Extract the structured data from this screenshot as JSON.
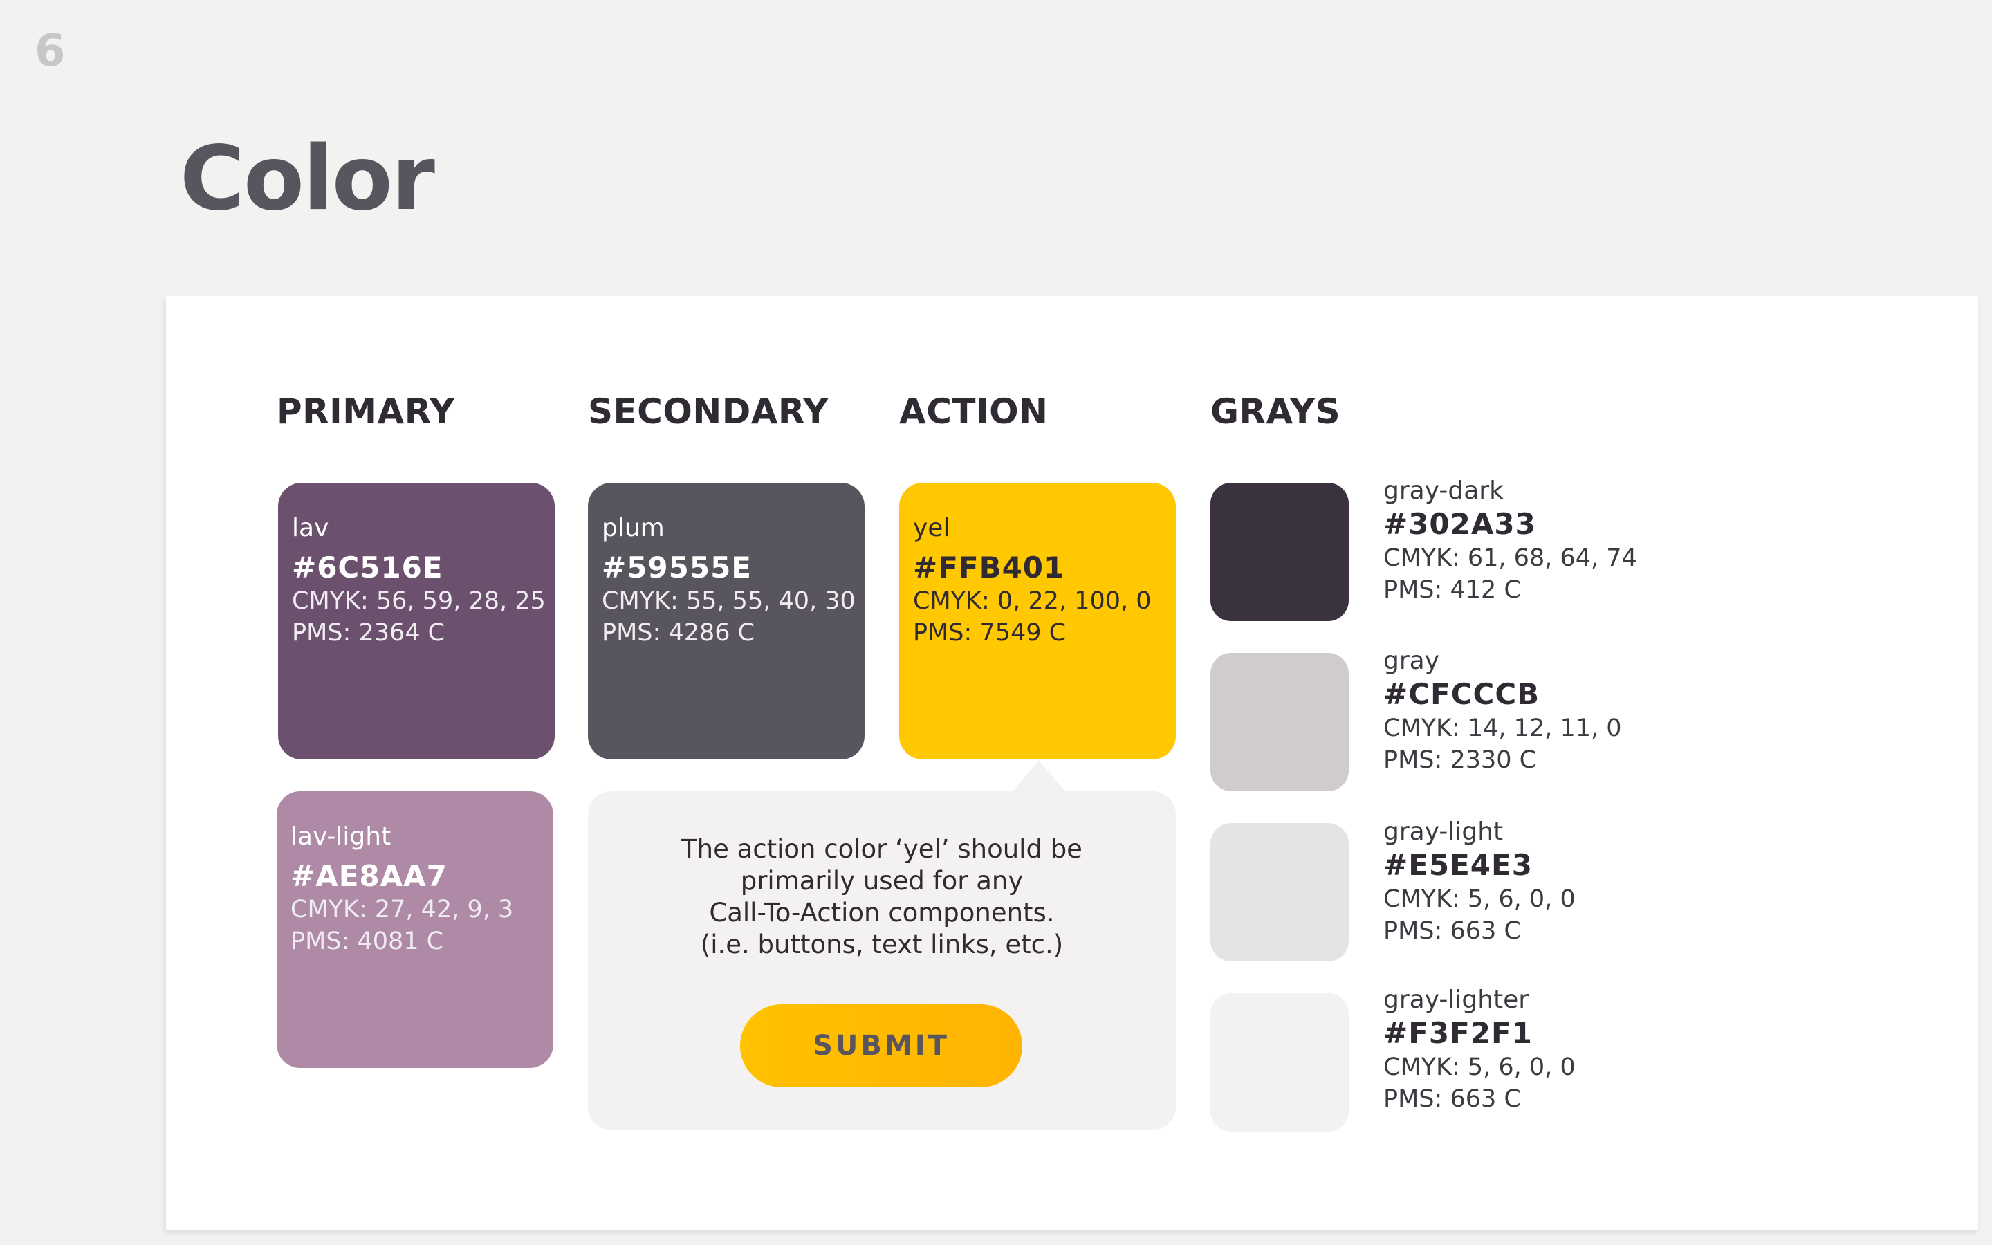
{
  "page": {
    "number": "6",
    "title": "Color"
  },
  "headings": {
    "primary": "PRIMARY",
    "secondary": "SECONDARY",
    "action": "ACTION",
    "grays": "GRAYS"
  },
  "colors": {
    "lav": {
      "name": "lav",
      "hex": "#6C516E",
      "cmyk": "CMYK: 56, 59, 28, 25",
      "pms": "PMS: 2364 C"
    },
    "lav_light": {
      "name": "lav-light",
      "hex": "#AE8AA7",
      "cmyk": "CMYK: 27, 42, 9, 3",
      "pms": "PMS: 4081 C"
    },
    "plum": {
      "name": "plum",
      "hex": "#59555E",
      "cmyk": "CMYK: 55, 55, 40, 30",
      "pms": "PMS: 4286 C"
    },
    "yel": {
      "name": "yel",
      "hex": "#FFB401",
      "cmyk": "CMYK: 0, 22, 100, 0",
      "pms": "PMS: 7549 C"
    }
  },
  "callout": {
    "lines": [
      "The action color ‘yel’ should be",
      "primarily used for any",
      "Call-To-Action components.",
      "(i.e. buttons, text links, etc.)"
    ],
    "button_label": "SUBMIT"
  },
  "grays": [
    {
      "name": "gray-dark",
      "hex": "#302A33",
      "cmyk": "CMYK: 61, 68, 64, 74",
      "pms": "PMS: 412 C"
    },
    {
      "name": "gray",
      "hex": "#CFCCCB",
      "cmyk": "CMYK: 14, 12, 11, 0",
      "pms": "PMS: 2330 C"
    },
    {
      "name": "gray-light",
      "hex": "#E5E4E3",
      "cmyk": "CMYK: 5, 6, 0, 0",
      "pms": "PMS: 663 C"
    },
    {
      "name": "gray-lighter",
      "hex": "#F3F2F1",
      "cmyk": "CMYK: 5, 6, 0, 0",
      "pms": "PMS: 663 C"
    }
  ]
}
